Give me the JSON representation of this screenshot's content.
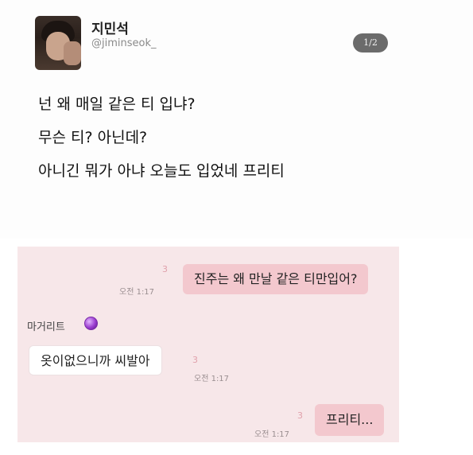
{
  "tweet": {
    "display_name": "지민석",
    "handle": "@jiminseok_",
    "page_counter": "1/2",
    "lines": [
      "넌 왜 매일 같은 티 입냐?",
      "무슨 티? 아닌데?",
      "아니긴 뭐가 아냐 오늘도 입었네 프리티"
    ]
  },
  "chat": {
    "messages": [
      {
        "text": "진주는 왜 만날 같은 티만입어?",
        "unread": "3",
        "time": "오전 1:17"
      },
      {
        "sender": "마거리트",
        "text": "옷이없으니까 씨발아",
        "unread": "3",
        "time": "오전 1:17"
      },
      {
        "text": "프리티...",
        "unread": "3",
        "time": "오전 1:17"
      }
    ],
    "colors": {
      "background": "#f7e7e9",
      "sent_bubble": "#f3c8ce",
      "received_bubble": "#ffffff",
      "unread_count": "#e0a1ab"
    }
  }
}
